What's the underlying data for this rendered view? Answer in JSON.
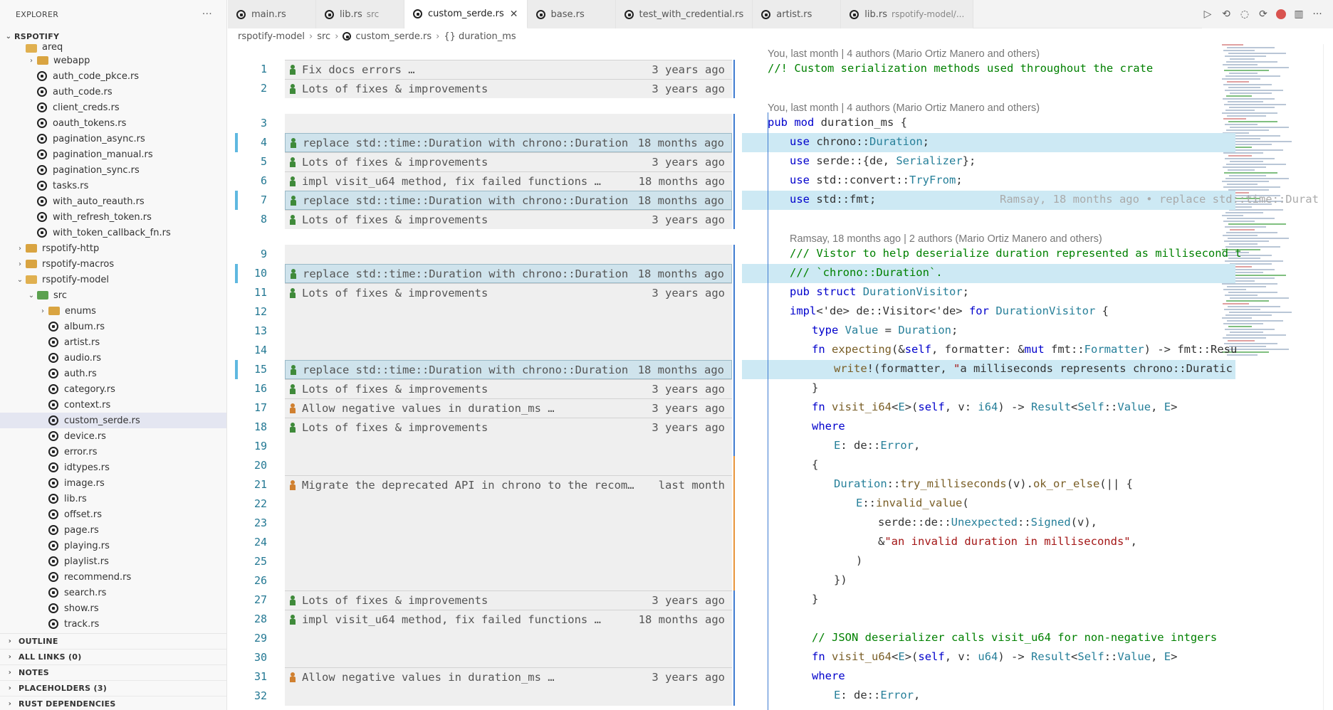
{
  "sidebar": {
    "title": "EXPLORER",
    "more": "···",
    "root": "RSPOTIFY",
    "items": [
      {
        "kind": "file",
        "depth": 1,
        "label": "areq"
      },
      {
        "kind": "folder",
        "depth": 2,
        "label": "webapp",
        "open": false
      },
      {
        "kind": "file",
        "depth": 2,
        "label": "auth_code_pkce.rs"
      },
      {
        "kind": "file",
        "depth": 2,
        "label": "auth_code.rs"
      },
      {
        "kind": "file",
        "depth": 2,
        "label": "client_creds.rs"
      },
      {
        "kind": "file",
        "depth": 2,
        "label": "oauth_tokens.rs"
      },
      {
        "kind": "file",
        "depth": 2,
        "label": "pagination_async.rs"
      },
      {
        "kind": "file",
        "depth": 2,
        "label": "pagination_manual.rs"
      },
      {
        "kind": "file",
        "depth": 2,
        "label": "pagination_sync.rs"
      },
      {
        "kind": "file",
        "depth": 2,
        "label": "tasks.rs"
      },
      {
        "kind": "file",
        "depth": 2,
        "label": "with_auto_reauth.rs"
      },
      {
        "kind": "file",
        "depth": 2,
        "label": "with_refresh_token.rs"
      },
      {
        "kind": "file",
        "depth": 2,
        "label": "with_token_callback_fn.rs"
      },
      {
        "kind": "folder",
        "depth": 1,
        "label": "rspotify-http",
        "open": false
      },
      {
        "kind": "folder",
        "depth": 1,
        "label": "rspotify-macros",
        "open": false
      },
      {
        "kind": "folder",
        "depth": 1,
        "label": "rspotify-model",
        "open": true
      },
      {
        "kind": "srcfolder",
        "depth": 2,
        "label": "src",
        "open": true
      },
      {
        "kind": "folder",
        "depth": 3,
        "label": "enums",
        "open": false
      },
      {
        "kind": "file",
        "depth": 3,
        "label": "album.rs"
      },
      {
        "kind": "file",
        "depth": 3,
        "label": "artist.rs"
      },
      {
        "kind": "file",
        "depth": 3,
        "label": "audio.rs"
      },
      {
        "kind": "file",
        "depth": 3,
        "label": "auth.rs"
      },
      {
        "kind": "file",
        "depth": 3,
        "label": "category.rs"
      },
      {
        "kind": "file",
        "depth": 3,
        "label": "context.rs"
      },
      {
        "kind": "file",
        "depth": 3,
        "label": "custom_serde.rs",
        "active": true
      },
      {
        "kind": "file",
        "depth": 3,
        "label": "device.rs"
      },
      {
        "kind": "file",
        "depth": 3,
        "label": "error.rs"
      },
      {
        "kind": "file",
        "depth": 3,
        "label": "idtypes.rs"
      },
      {
        "kind": "file",
        "depth": 3,
        "label": "image.rs"
      },
      {
        "kind": "file",
        "depth": 3,
        "label": "lib.rs"
      },
      {
        "kind": "file",
        "depth": 3,
        "label": "offset.rs"
      },
      {
        "kind": "file",
        "depth": 3,
        "label": "page.rs"
      },
      {
        "kind": "file",
        "depth": 3,
        "label": "playing.rs"
      },
      {
        "kind": "file",
        "depth": 3,
        "label": "playlist.rs"
      },
      {
        "kind": "file",
        "depth": 3,
        "label": "recommend.rs"
      },
      {
        "kind": "file",
        "depth": 3,
        "label": "search.rs"
      },
      {
        "kind": "file",
        "depth": 3,
        "label": "show.rs"
      },
      {
        "kind": "file",
        "depth": 3,
        "label": "track.rs"
      }
    ],
    "panels": [
      "OUTLINE",
      "ALL LINKS (0)",
      "NOTES",
      "PLACEHOLDERS (3)",
      "RUST DEPENDENCIES"
    ]
  },
  "tabs": [
    {
      "label": "main.rs",
      "desc": ""
    },
    {
      "label": "lib.rs",
      "desc": "src"
    },
    {
      "label": "custom_serde.rs",
      "desc": "",
      "active": true
    },
    {
      "label": "base.rs",
      "desc": ""
    },
    {
      "label": "test_with_credential.rs",
      "desc": ""
    },
    {
      "label": "artist.rs",
      "desc": ""
    },
    {
      "label": "lib.rs",
      "desc": "rspotify-model/..."
    }
  ],
  "breadcrumb": [
    "rspotify-model",
    "src",
    "custom_serde.rs",
    "{} duration_ms"
  ],
  "lenses": [
    {
      "before_line": 1,
      "text": "You, last month | 4 authors (Mario Ortiz Manero and others)",
      "indent": 0
    },
    {
      "before_line": 3,
      "text": "You, last month | 4 authors (Mario Ortiz Manero and others)",
      "indent": 0
    },
    {
      "before_line": 9,
      "text": "Ramsay, 18 months ago | 2 authors (Mario Ortiz Manero and others)",
      "indent": 1
    }
  ],
  "lines": [
    {
      "n": 1,
      "blame": "Fix docs errors …",
      "time": "3 years ago",
      "code": "//! Custom serialization methods used throughout the crate",
      "indent": 0,
      "style": "cm"
    },
    {
      "n": 2,
      "blame": "Lots of fixes & improvements",
      "time": "3 years ago",
      "code": "",
      "indent": 0
    },
    {
      "n": 3,
      "blame": "",
      "time": "",
      "code": "pub mod duration_ms {",
      "indent": 0
    },
    {
      "n": 4,
      "blame": "replace std::time::Duration with chrono::Duration",
      "time": "18 months ago",
      "code": "use chrono::Duration;",
      "indent": 1,
      "hl": true
    },
    {
      "n": 5,
      "blame": "Lots of fixes & improvements",
      "time": "3 years ago",
      "code": "use serde::{de, Serializer};",
      "indent": 1
    },
    {
      "n": 6,
      "blame": "impl visit_u64 method, fix failed functions …",
      "time": "18 months ago",
      "code": "use std::convert::TryFrom;",
      "indent": 1
    },
    {
      "n": 7,
      "blame": "replace std::time::Duration with chrono::Duration",
      "time": "18 months ago",
      "code": "use std::fmt;",
      "indent": 1,
      "hl": true,
      "inline": "Ramsay, 18 months ago • replace std::time::Durat"
    },
    {
      "n": 8,
      "blame": "Lots of fixes & improvements",
      "time": "3 years ago",
      "code": "",
      "indent": 0
    },
    {
      "n": 9,
      "blame": "",
      "time": "",
      "code": "/// Vistor to help deserialize duration represented as millisecond t",
      "indent": 1,
      "style": "cm"
    },
    {
      "n": 10,
      "blame": "replace std::time::Duration with chrono::Duration",
      "time": "18 months ago",
      "code": "/// `chrono::Duration`.",
      "indent": 1,
      "style": "cm",
      "hl": true
    },
    {
      "n": 11,
      "blame": "Lots of fixes & improvements",
      "time": "3 years ago",
      "code": "pub struct DurationVisitor;",
      "indent": 1
    },
    {
      "n": 12,
      "blame": "",
      "time": "",
      "code": "impl<'de> de::Visitor<'de> for DurationVisitor {",
      "indent": 1
    },
    {
      "n": 13,
      "blame": "",
      "time": "",
      "code": "type Value = Duration;",
      "indent": 2
    },
    {
      "n": 14,
      "blame": "",
      "time": "",
      "code": "fn expecting(&self, formatter: &mut fmt::Formatter) -> fmt::Resu",
      "indent": 2
    },
    {
      "n": 15,
      "blame": "replace std::time::Duration with chrono::Duration",
      "time": "18 months ago",
      "code": "write!(formatter, \"a milliseconds represents chrono::Duratic",
      "indent": 3,
      "hl": true
    },
    {
      "n": 16,
      "blame": "Lots of fixes & improvements",
      "time": "3 years ago",
      "code": "}",
      "indent": 2
    },
    {
      "n": 17,
      "blame": "Allow negative values in duration_ms …",
      "time": "3 years ago",
      "code": "fn visit_i64<E>(self, v: i64) -> Result<Self::Value, E>",
      "indent": 2,
      "orange": true
    },
    {
      "n": 18,
      "blame": "Lots of fixes & improvements",
      "time": "3 years ago",
      "code": "where",
      "indent": 2
    },
    {
      "n": 19,
      "blame": "",
      "time": "",
      "code": "E: de::Error,",
      "indent": 3
    },
    {
      "n": 20,
      "blame": "",
      "time": "",
      "code": "{",
      "indent": 2
    },
    {
      "n": 21,
      "blame": "Migrate the deprecated API in chrono to the recom…",
      "time": "last month",
      "code": "Duration::try_milliseconds(v).ok_or_else(|| {",
      "indent": 3,
      "orange": true
    },
    {
      "n": 22,
      "blame": "",
      "time": "",
      "code": "E::invalid_value(",
      "indent": 4
    },
    {
      "n": 23,
      "blame": "",
      "time": "",
      "code": "serde::de::Unexpected::Signed(v),",
      "indent": 5
    },
    {
      "n": 24,
      "blame": "",
      "time": "",
      "code": "&\"an invalid duration in milliseconds\",",
      "indent": 5
    },
    {
      "n": 25,
      "blame": "",
      "time": "",
      "code": ")",
      "indent": 4
    },
    {
      "n": 26,
      "blame": "",
      "time": "",
      "code": "})",
      "indent": 3
    },
    {
      "n": 27,
      "blame": "Lots of fixes & improvements",
      "time": "3 years ago",
      "code": "}",
      "indent": 2
    },
    {
      "n": 28,
      "blame": "impl visit_u64 method, fix failed functions …",
      "time": "18 months ago",
      "code": "",
      "indent": 0
    },
    {
      "n": 29,
      "blame": "",
      "time": "",
      "code": "// JSON deserializer calls visit_u64 for non-negative intgers",
      "indent": 2,
      "style": "cm"
    },
    {
      "n": 30,
      "blame": "",
      "time": "",
      "code": "fn visit_u64<E>(self, v: u64) -> Result<Self::Value, E>",
      "indent": 2
    },
    {
      "n": 31,
      "blame": "Allow negative values in duration_ms …",
      "time": "3 years ago",
      "code": "where",
      "indent": 2,
      "orange": true
    },
    {
      "n": 32,
      "blame": "",
      "time": "",
      "code": "E: de::Error,",
      "indent": 3
    }
  ]
}
